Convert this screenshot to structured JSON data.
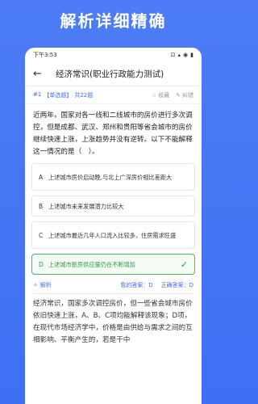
{
  "banner": {
    "title": "解析详细精确"
  },
  "statusbar": {
    "time": "下午3:53",
    "icons": [
      "⊡",
      "▴",
      "◉",
      "▮"
    ]
  },
  "header": {
    "title": "经济常识(职业行政能力测试)"
  },
  "question_meta": {
    "index": "#1",
    "type": "【单选题】",
    "total": "共22题",
    "favorite_label": "收藏",
    "report_label": "纠错"
  },
  "question": {
    "text": "近两年，国家对各一线和二线城市的房价进行多次调控，但是成都、武汉、郑州和贵阳等省会城市的房价继续快速上涨，上涨趋势并没有逆转。以下不能解释这一情况的是（　）。"
  },
  "options": [
    {
      "letter": "A",
      "text": "上述城市房价启动晚,与北上广深房价相比差距大"
    },
    {
      "letter": "B",
      "text": "上述城市未来发展潜力比较大"
    },
    {
      "letter": "C",
      "text": "上述城市最近几年人口流入比较多，住房需求旺盛"
    },
    {
      "letter": "D",
      "text": "上述城市新房供应量仍在不断增加",
      "correct": true
    }
  ],
  "analysis": {
    "label": "解析",
    "my_answer": "我的答案：D",
    "correct_answer": "正确答案：D",
    "text": "经济常识，国家多次调控房价，但一些省会城市房价依旧快速上涨，A、B、C项均能解释该现象；D项，在现代市场经济学中，价格是由供给与需求之间的互相影响、平衡产生的，若是干中"
  },
  "colors": {
    "accent": "#3f6ff3",
    "correct": "#47b760"
  }
}
